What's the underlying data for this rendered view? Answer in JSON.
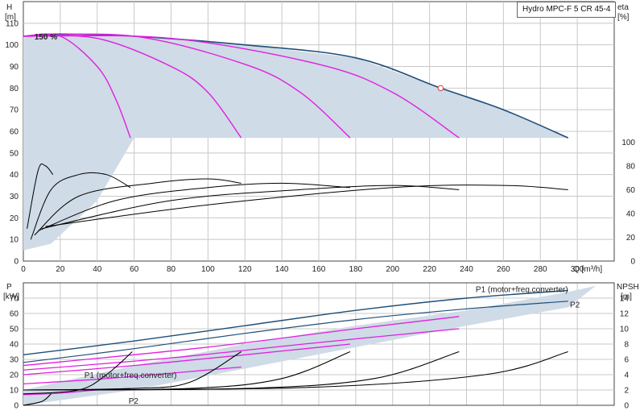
{
  "legend_title": "Hydro MPC-F 5 CR 45-4",
  "colors": {
    "envelope": "#cfdbe6",
    "boundary": "#1f4e79",
    "speed_curve": "#e020e0",
    "eff_curve": "#000000",
    "grid": "#c8c8c8"
  },
  "chart_data": [
    {
      "type": "line",
      "id": "head",
      "xlabel": "Q [m³/h]",
      "ylabel_left": [
        "H",
        "[m]"
      ],
      "ylabel_right": [
        "eta",
        "[%]"
      ],
      "xlim": [
        0,
        320
      ],
      "ylim": [
        0,
        120
      ],
      "x_ticks": [
        0,
        20,
        40,
        60,
        80,
        100,
        120,
        140,
        160,
        180,
        200,
        220,
        240,
        260,
        280,
        300
      ],
      "y_ticks": [
        0,
        10,
        20,
        30,
        40,
        50,
        60,
        70,
        80,
        90,
        100,
        110
      ],
      "right_ticks": [
        0,
        20,
        40,
        60,
        80,
        100
      ],
      "eta_scale": {
        "value_0_at_H": 0,
        "value_100_at_H": 55
      },
      "speed_label": "150 %",
      "duty_point": {
        "x": 226,
        "y": 80
      },
      "boundary": [
        [
          0,
          104
        ],
        [
          20,
          105
        ],
        [
          60,
          104
        ],
        [
          120,
          100
        ],
        [
          180,
          94
        ],
        [
          226,
          80
        ],
        [
          260,
          70
        ],
        [
          295,
          57
        ]
      ],
      "envelope_bottom": [
        [
          0,
          5
        ],
        [
          15,
          8
        ],
        [
          40,
          28
        ],
        [
          60,
          57
        ],
        [
          295,
          57
        ]
      ],
      "speed_curves": [
        [
          [
            0,
            104
          ],
          [
            20,
            104
          ],
          [
            40,
            90
          ],
          [
            50,
            75
          ],
          [
            58,
            57
          ]
        ],
        [
          [
            0,
            104
          ],
          [
            40,
            103
          ],
          [
            80,
            90
          ],
          [
            100,
            78
          ],
          [
            118,
            57
          ]
        ],
        [
          [
            0,
            104
          ],
          [
            60,
            104
          ],
          [
            120,
            91
          ],
          [
            150,
            78
          ],
          [
            177,
            57
          ]
        ],
        [
          [
            0,
            104
          ],
          [
            80,
            103
          ],
          [
            160,
            91
          ],
          [
            200,
            78
          ],
          [
            236,
            57
          ]
        ]
      ],
      "efficiency_curves": [
        [
          [
            2,
            15
          ],
          [
            8,
            42
          ],
          [
            12,
            44
          ],
          [
            16,
            40
          ]
        ],
        [
          [
            4,
            10
          ],
          [
            15,
            33
          ],
          [
            30,
            40
          ],
          [
            45,
            40
          ],
          [
            58,
            34
          ]
        ],
        [
          [
            6,
            12
          ],
          [
            30,
            30
          ],
          [
            70,
            36
          ],
          [
            100,
            38
          ],
          [
            118,
            36
          ]
        ],
        [
          [
            8,
            14
          ],
          [
            50,
            28
          ],
          [
            100,
            34
          ],
          [
            140,
            36
          ],
          [
            177,
            34
          ]
        ],
        [
          [
            10,
            15
          ],
          [
            80,
            28
          ],
          [
            150,
            33
          ],
          [
            200,
            35
          ],
          [
            236,
            33
          ]
        ],
        [
          [
            12,
            16
          ],
          [
            100,
            26
          ],
          [
            200,
            34
          ],
          [
            260,
            35
          ],
          [
            295,
            33
          ]
        ]
      ]
    },
    {
      "type": "line",
      "id": "power",
      "ylabel_left": [
        "P",
        "[kW]"
      ],
      "ylabel_right": [
        "NPSH",
        "[m]"
      ],
      "xlim": [
        0,
        320
      ],
      "ylim": [
        0,
        80
      ],
      "y_ticks": [
        0,
        10,
        20,
        30,
        40,
        50,
        60,
        70
      ],
      "right_ticks": [
        0,
        2,
        4,
        6,
        8,
        10,
        12,
        14
      ],
      "npsh_scale": {
        "value_0_at_P": 0,
        "value_14_at_P": 70
      },
      "annotations": [
        {
          "text": "P1 (motor+freq.converter)",
          "x": 270,
          "y": 74
        },
        {
          "text": "P2",
          "x": 296,
          "y": 64
        },
        {
          "text": "P1 (motor+freq.converter)",
          "x": 33,
          "y": 18
        },
        {
          "text": "P2",
          "x": 57,
          "y": 1
        }
      ],
      "envelope": [
        [
          0,
          10
        ],
        [
          60,
          26
        ],
        [
          120,
          40
        ],
        [
          180,
          52
        ],
        [
          240,
          62
        ],
        [
          295,
          74
        ],
        [
          310,
          78
        ],
        [
          295,
          64
        ],
        [
          240,
          52
        ],
        [
          180,
          38
        ],
        [
          120,
          24
        ],
        [
          60,
          10
        ],
        [
          0,
          0
        ]
      ],
      "p1_max": [
        [
          0,
          33
        ],
        [
          60,
          42
        ],
        [
          120,
          52
        ],
        [
          180,
          62
        ],
        [
          240,
          70
        ],
        [
          295,
          75
        ]
      ],
      "p2_max": [
        [
          0,
          28
        ],
        [
          60,
          37
        ],
        [
          120,
          47
        ],
        [
          180,
          56
        ],
        [
          240,
          63
        ],
        [
          295,
          68
        ]
      ],
      "magenta_curves": [
        [
          [
            0,
            7
          ],
          [
            20,
            8
          ],
          [
            40,
            10
          ],
          [
            58,
            11
          ]
        ],
        [
          [
            0,
            14
          ],
          [
            40,
            17
          ],
          [
            80,
            21
          ],
          [
            118,
            25
          ]
        ],
        [
          [
            0,
            20
          ],
          [
            60,
            26
          ],
          [
            120,
            33
          ],
          [
            177,
            40
          ]
        ],
        [
          [
            0,
            23
          ],
          [
            80,
            31
          ],
          [
            160,
            41
          ],
          [
            236,
            50
          ]
        ],
        [
          [
            0,
            26
          ],
          [
            100,
            38
          ],
          [
            180,
            50
          ],
          [
            236,
            58
          ]
        ]
      ],
      "npsh_curves": [
        [
          [
            0,
            0
          ],
          [
            10,
            0.5
          ],
          [
            15,
            1.5
          ]
        ],
        [
          [
            0,
            1.5
          ],
          [
            30,
            2
          ],
          [
            45,
            4
          ],
          [
            59,
            7
          ]
        ],
        [
          [
            0,
            2
          ],
          [
            60,
            2.2
          ],
          [
            90,
            3
          ],
          [
            118,
            7
          ]
        ],
        [
          [
            0,
            2
          ],
          [
            90,
            2.2
          ],
          [
            140,
            3.5
          ],
          [
            177,
            7
          ]
        ],
        [
          [
            0,
            2
          ],
          [
            120,
            2.2
          ],
          [
            190,
            3.5
          ],
          [
            236,
            7
          ]
        ],
        [
          [
            0,
            2
          ],
          [
            150,
            2.3
          ],
          [
            250,
            4
          ],
          [
            295,
            7
          ]
        ]
      ]
    }
  ]
}
